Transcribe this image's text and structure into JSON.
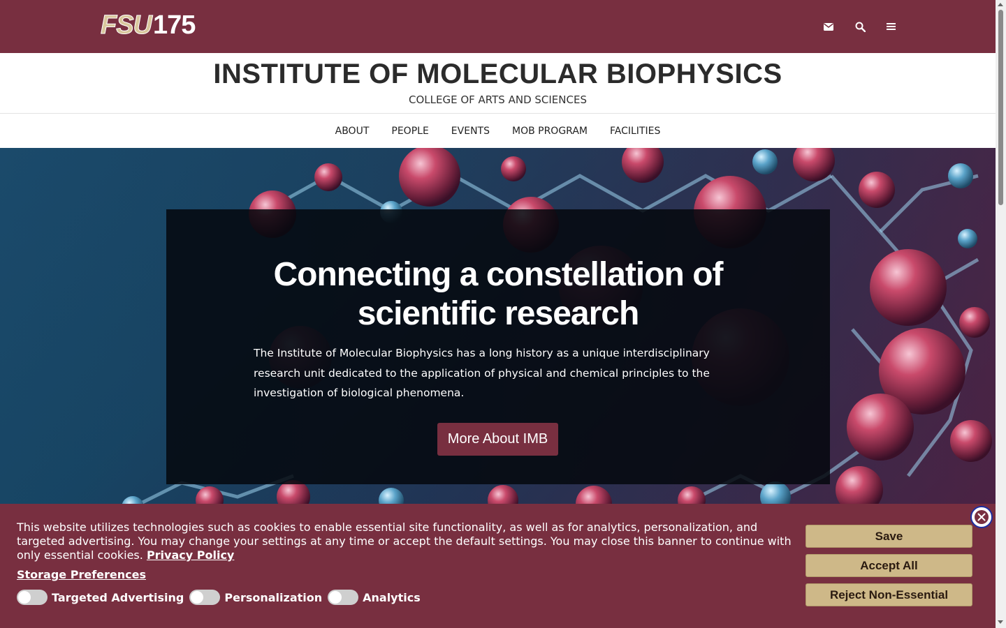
{
  "topbar": {
    "logo_fsu": "FSU",
    "logo_number": "175",
    "colors": {
      "garnet": "#782f40",
      "gold": "#ceb888"
    },
    "icons": [
      "envelope-icon",
      "search-icon",
      "menu-icon"
    ]
  },
  "header": {
    "title": "INSTITUTE OF MOLECULAR BIOPHYSICS",
    "subtitle": "COLLEGE OF ARTS AND SCIENCES"
  },
  "nav": {
    "items": [
      {
        "label": "ABOUT"
      },
      {
        "label": "PEOPLE"
      },
      {
        "label": "EVENTS"
      },
      {
        "label": "MOB PROGRAM"
      },
      {
        "label": "FACILITIES"
      }
    ]
  },
  "hero": {
    "title_line1": "Connecting a constellation of",
    "title_line2": "scientific research",
    "text": "The Institute of Molecular Biophysics has a long history as a unique interdisciplinary research unit dedicated to the application of physical and chemical principles to the investigation of biological phenomena.",
    "button_label": "More About IMB"
  },
  "cookie_banner": {
    "text": "This website utilizes technologies such as cookies to enable essential site functionality, as well as for analytics, personalization, and targeted advertising. You may change your settings at any time or accept the default settings. You may close this banner to continue with only essential cookies.",
    "privacy_link": "Privacy Policy",
    "storage_preferences": "Storage Preferences",
    "toggles": [
      {
        "label": "Targeted Advertising",
        "on": false
      },
      {
        "label": "Personalization",
        "on": false
      },
      {
        "label": "Analytics",
        "on": false
      }
    ],
    "buttons": {
      "save": "Save",
      "accept_all": "Accept All",
      "reject": "Reject Non-Essential"
    }
  }
}
